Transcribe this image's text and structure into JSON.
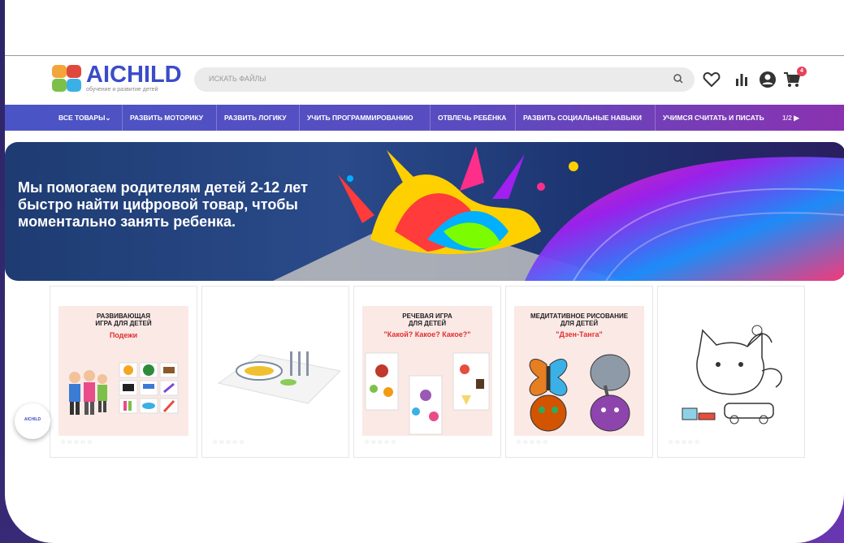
{
  "header": {
    "logo_title": "AICHILD",
    "logo_subtitle": "обучение и развитие детей",
    "search_placeholder": "ИСКАТЬ ФАЙЛЫ",
    "cart_count": "4"
  },
  "nav": {
    "items": [
      {
        "label": "ВСЕ ТОВАРЫ"
      },
      {
        "label": "РАЗВИТЬ МОТОРИКУ"
      },
      {
        "label": "РАЗВИТЬ ЛОГИКУ"
      },
      {
        "label": "УЧИТЬ ПРОГРАММИРОВАНИЮ"
      },
      {
        "label": "ОТВЛЕЧЬ РЕБЁНКА"
      },
      {
        "label": "РАЗВИТЬ СОЦИАЛЬНЫЕ НАВЫКИ"
      },
      {
        "label": "УЧИМСЯ СЧИТАТЬ И ПИСАТЬ"
      }
    ],
    "pager": "1/2"
  },
  "banner": {
    "line1": "Мы помогаем родителям детей 2-12 лет",
    "line2": "быстро найти цифровой товар, чтобы",
    "line3": "моментально занять ребенка."
  },
  "products": [
    {
      "title1": "РАЗВИВАЮЩАЯ",
      "title2": "ИГРА ДЛЯ ДЕТЕЙ",
      "subtitle": "Подежи",
      "stars": "☆☆☆☆☆"
    },
    {
      "title1": "",
      "title2": "",
      "subtitle": "",
      "stars": "☆☆☆☆☆"
    },
    {
      "title1": "РЕЧЕВАЯ ИГРА",
      "title2": "ДЛЯ ДЕТЕЙ",
      "subtitle": "\"Какой? Какое? Какое?\"",
      "stars": "☆☆☆☆☆"
    },
    {
      "title1": "МЕДИТАТИВНОЕ РИСОВАНИЕ",
      "title2": "ДЛЯ ДЕТЕЙ",
      "subtitle": "\"Дзен-Танга\"",
      "stars": "☆☆☆☆☆"
    },
    {
      "title1": "",
      "title2": "",
      "subtitle": "",
      "stars": "☆☆☆☆☆"
    }
  ],
  "chat_widget": {
    "label": "AICHILD"
  },
  "colors": {
    "brand": "#3b4cc9",
    "nav_start": "#4a54c4",
    "nav_end": "#8a32b0",
    "badge": "#e8425a"
  },
  "icons": [
    "search-icon",
    "heart-icon",
    "chart-icon",
    "user-icon",
    "cart-icon",
    "chevron-down-icon",
    "chevron-right-icon"
  ]
}
